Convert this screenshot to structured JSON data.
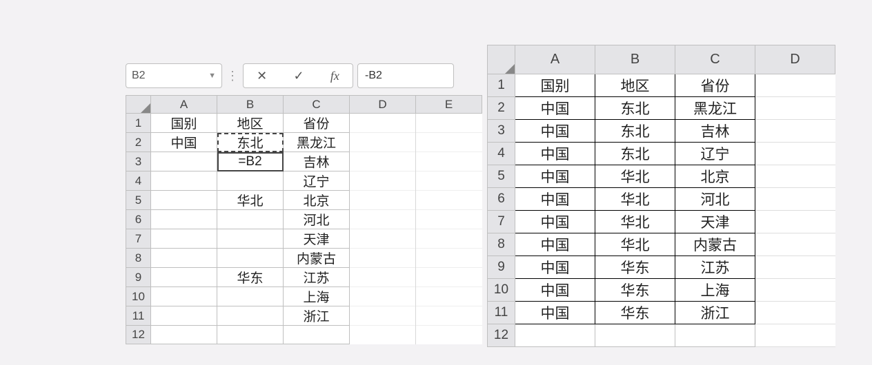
{
  "left": {
    "nameBox": "B2",
    "formulaInput": "-B2",
    "colHeaders": [
      "A",
      "B",
      "C",
      "D",
      "E"
    ],
    "rowHeaders": [
      "1",
      "2",
      "3",
      "4",
      "5",
      "6",
      "7",
      "8",
      "9",
      "10",
      "11",
      "12"
    ],
    "rows": [
      {
        "A": "国别",
        "B": "地区",
        "C": "省份"
      },
      {
        "A": "中国",
        "B": "东北",
        "C": "黑龙江"
      },
      {
        "A": "",
        "B": "=B2",
        "C": "吉林"
      },
      {
        "A": "",
        "B": "",
        "C": "辽宁"
      },
      {
        "A": "",
        "B": "华北",
        "C": "北京"
      },
      {
        "A": "",
        "B": "",
        "C": "河北"
      },
      {
        "A": "",
        "B": "",
        "C": "天津"
      },
      {
        "A": "",
        "B": "",
        "C": "内蒙古"
      },
      {
        "A": "",
        "B": "华东",
        "C": "江苏"
      },
      {
        "A": "",
        "B": "",
        "C": "上海"
      },
      {
        "A": "",
        "B": "",
        "C": "浙江"
      },
      {
        "A": "",
        "B": "",
        "C": ""
      }
    ],
    "copiedCell": "B2",
    "editingCell": "B3"
  },
  "right": {
    "colHeaders": [
      "A",
      "B",
      "C",
      "D"
    ],
    "rowHeaders": [
      "1",
      "2",
      "3",
      "4",
      "5",
      "6",
      "7",
      "8",
      "9",
      "10",
      "11",
      "12"
    ],
    "rows": [
      {
        "A": "国别",
        "B": "地区",
        "C": "省份"
      },
      {
        "A": "中国",
        "B": "东北",
        "C": "黑龙江"
      },
      {
        "A": "中国",
        "B": "东北",
        "C": "吉林"
      },
      {
        "A": "中国",
        "B": "东北",
        "C": "辽宁"
      },
      {
        "A": "中国",
        "B": "华北",
        "C": "北京"
      },
      {
        "A": "中国",
        "B": "华北",
        "C": "河北"
      },
      {
        "A": "中国",
        "B": "华北",
        "C": "天津"
      },
      {
        "A": "中国",
        "B": "华北",
        "C": "内蒙古"
      },
      {
        "A": "中国",
        "B": "华东",
        "C": "江苏"
      },
      {
        "A": "中国",
        "B": "华东",
        "C": "上海"
      },
      {
        "A": "中国",
        "B": "华东",
        "C": "浙江"
      },
      {
        "A": "",
        "B": "",
        "C": ""
      }
    ]
  }
}
